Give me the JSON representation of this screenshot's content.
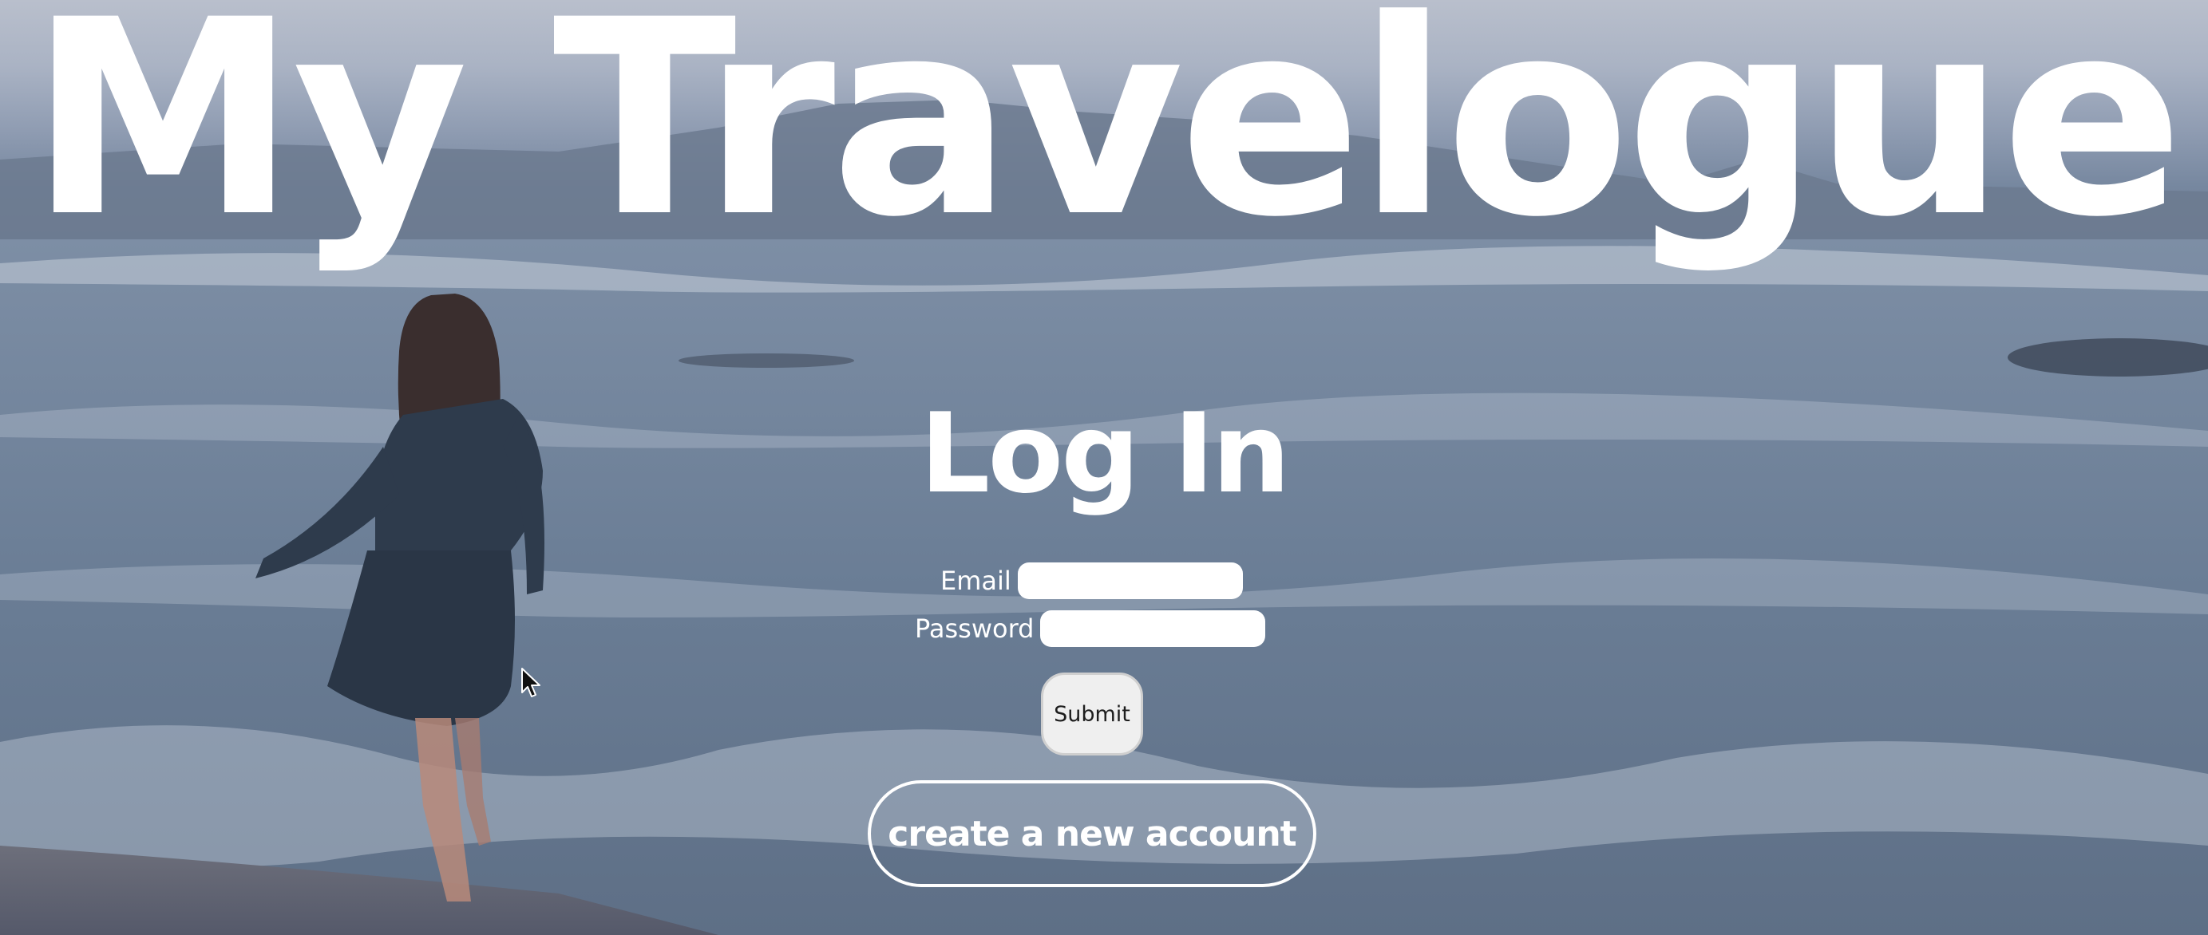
{
  "site": {
    "title": "My Travelogue"
  },
  "login": {
    "heading": "Log In",
    "email_label": "Email",
    "email_value": "",
    "password_label": "Password",
    "password_value": "",
    "submit_label": "Submit",
    "create_account_label": "create a new account"
  },
  "background": {
    "description_icon": "ocean-beach-photo",
    "colors": {
      "sky": "#b9bfcc",
      "sea": "#6f8198",
      "foam": "#c9d2de",
      "text": "#ffffff"
    }
  }
}
